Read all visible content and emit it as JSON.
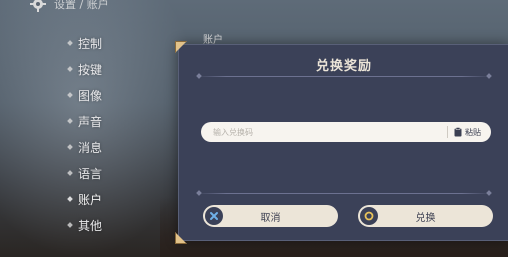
{
  "header": {
    "title": "设置 / 账户",
    "icon": "gear-icon"
  },
  "sidebar": {
    "items": [
      {
        "label": "控制"
      },
      {
        "label": "按键"
      },
      {
        "label": "图像"
      },
      {
        "label": "声音"
      },
      {
        "label": "消息"
      },
      {
        "label": "语言"
      },
      {
        "label": "账户",
        "active": true
      },
      {
        "label": "其他"
      }
    ]
  },
  "section": {
    "label": "账户"
  },
  "dialog": {
    "title": "兑换奖励",
    "code_input": {
      "placeholder": "输入兑换码",
      "value": ""
    },
    "paste_label": "粘贴",
    "cancel_label": "取消",
    "confirm_label": "兑换",
    "cancel_icon": "x-icon",
    "confirm_icon": "circle-icon"
  },
  "colors": {
    "dialog_bg": "#3b4158",
    "button_bg": "#ece5d8",
    "accent_gold": "#e2c28a"
  }
}
